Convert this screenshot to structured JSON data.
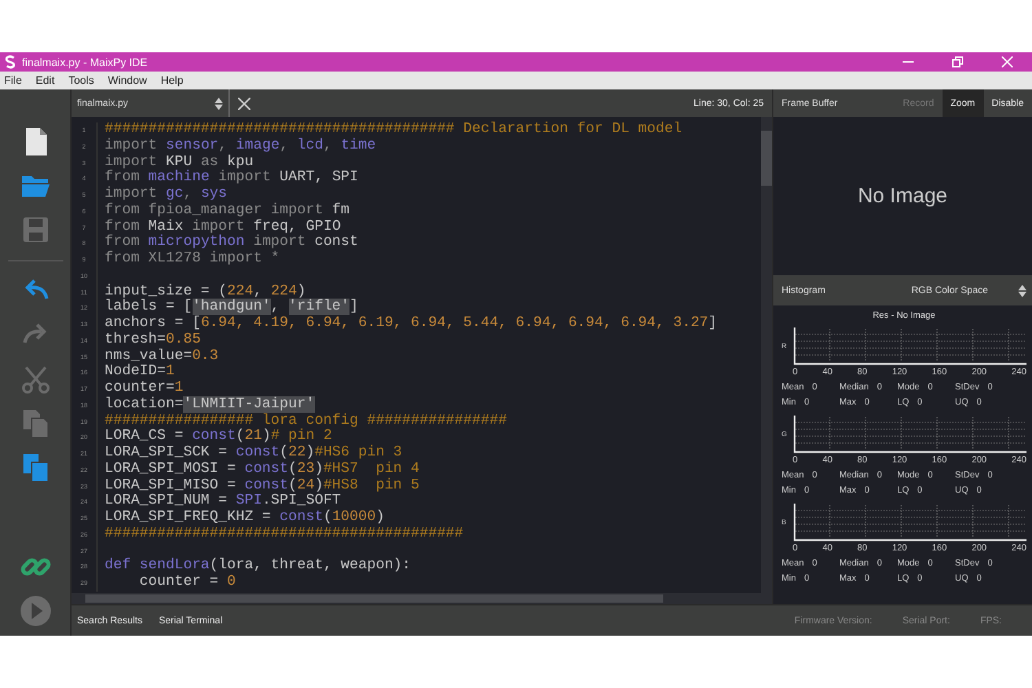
{
  "window": {
    "title": "finalmaix.py - MaixPy IDE"
  },
  "menu": [
    "File",
    "Edit",
    "Tools",
    "Window",
    "Help"
  ],
  "toolbar": [
    {
      "kind": "new",
      "enabled": true
    },
    {
      "kind": "open",
      "enabled": true
    },
    {
      "kind": "save",
      "enabled": false
    },
    {
      "kind": "undo",
      "enabled": true
    },
    {
      "kind": "redo",
      "enabled": false
    },
    {
      "kind": "cut",
      "enabled": false
    },
    {
      "kind": "copy",
      "enabled": false
    },
    {
      "kind": "paste",
      "enabled": true
    }
  ],
  "device_controls": [
    {
      "kind": "connect",
      "enabled": true
    },
    {
      "kind": "run",
      "enabled": false
    }
  ],
  "editor": {
    "file": "finalmaix.py",
    "cursor": "Line: 30, Col: 25",
    "lines": [
      {
        "number": "1",
        "tokens": [
          {
            "kind": "comment",
            "text": "######################################## Declarartion for DL model"
          }
        ]
      },
      {
        "number": "2",
        "tokens": [
          {
            "kind": "muted",
            "text": "import "
          },
          {
            "kind": "accent",
            "text": "sensor"
          },
          {
            "kind": "muted",
            "text": ", "
          },
          {
            "kind": "accent",
            "text": "image"
          },
          {
            "kind": "muted",
            "text": ", "
          },
          {
            "kind": "accent",
            "text": "lcd"
          },
          {
            "kind": "muted",
            "text": ", "
          },
          {
            "kind": "accent",
            "text": "time"
          }
        ]
      },
      {
        "number": "3",
        "tokens": [
          {
            "kind": "muted",
            "text": "import "
          },
          {
            "kind": "plain",
            "text": "KPU "
          },
          {
            "kind": "muted",
            "text": "as "
          },
          {
            "kind": "plain",
            "text": "kpu"
          }
        ]
      },
      {
        "number": "4",
        "tokens": [
          {
            "kind": "muted",
            "text": "from "
          },
          {
            "kind": "accent",
            "text": "machine"
          },
          {
            "kind": "muted",
            "text": " import "
          },
          {
            "kind": "plain",
            "text": "UART, SPI"
          }
        ]
      },
      {
        "number": "5",
        "tokens": [
          {
            "kind": "muted",
            "text": "import "
          },
          {
            "kind": "accent",
            "text": "gc"
          },
          {
            "kind": "muted",
            "text": ", "
          },
          {
            "kind": "accent",
            "text": "sys"
          }
        ]
      },
      {
        "number": "6",
        "tokens": [
          {
            "kind": "muted",
            "text": "from fpioa_manager import "
          },
          {
            "kind": "plain",
            "text": "fm"
          }
        ]
      },
      {
        "number": "7",
        "tokens": [
          {
            "kind": "muted",
            "text": "from "
          },
          {
            "kind": "plain",
            "text": "Maix "
          },
          {
            "kind": "muted",
            "text": "import "
          },
          {
            "kind": "plain",
            "text": "freq, GPIO"
          }
        ]
      },
      {
        "number": "8",
        "tokens": [
          {
            "kind": "muted",
            "text": "from "
          },
          {
            "kind": "accent",
            "text": "micropython"
          },
          {
            "kind": "muted",
            "text": " import "
          },
          {
            "kind": "plain",
            "text": "const"
          }
        ]
      },
      {
        "number": "9",
        "tokens": [
          {
            "kind": "muted",
            "text": "from XL1278 import *"
          }
        ]
      },
      {
        "number": "10"
      },
      {
        "number": "11",
        "tokens": [
          {
            "kind": "plain",
            "text": "input_size = ("
          },
          {
            "kind": "number",
            "text": "224"
          },
          {
            "kind": "plain",
            "text": ", "
          },
          {
            "kind": "number",
            "text": "224"
          },
          {
            "kind": "plain",
            "text": ")"
          }
        ]
      },
      {
        "number": "12",
        "tokens": [
          {
            "kind": "plain",
            "text": "labels = ["
          },
          {
            "kind": "string",
            "text": "'handgun'"
          },
          {
            "kind": "plain",
            "text": ", "
          },
          {
            "kind": "string",
            "text": "'rifle'"
          },
          {
            "kind": "plain",
            "text": "]"
          }
        ]
      },
      {
        "number": "13",
        "tokens": [
          {
            "kind": "plain",
            "text": "anchors = ["
          },
          {
            "kind": "number",
            "text": "6.94, 4.19, 6.94, 6.19, 6.94, 5.44, 6.94, 6.94, 6.94, 3.27"
          },
          {
            "kind": "plain",
            "text": "]"
          }
        ]
      },
      {
        "number": "14",
        "tokens": [
          {
            "kind": "plain",
            "text": "thresh="
          },
          {
            "kind": "number",
            "text": "0.85"
          }
        ]
      },
      {
        "number": "15",
        "tokens": [
          {
            "kind": "plain",
            "text": "nms_value="
          },
          {
            "kind": "number",
            "text": "0.3"
          }
        ]
      },
      {
        "number": "16",
        "tokens": [
          {
            "kind": "plain",
            "text": "NodeID="
          },
          {
            "kind": "number",
            "text": "1"
          }
        ]
      },
      {
        "number": "17",
        "tokens": [
          {
            "kind": "plain",
            "text": "counter="
          },
          {
            "kind": "number",
            "text": "1"
          }
        ]
      },
      {
        "number": "18",
        "tokens": [
          {
            "kind": "plain",
            "text": "location="
          },
          {
            "kind": "string",
            "text": "'LNMIIT-Jaipur'"
          }
        ]
      },
      {
        "number": "19",
        "tokens": [
          {
            "kind": "comment",
            "text": "################# lora config ################"
          }
        ]
      },
      {
        "number": "20",
        "tokens": [
          {
            "kind": "plain",
            "text": "LORA_CS = "
          },
          {
            "kind": "accent",
            "text": "const"
          },
          {
            "kind": "plain",
            "text": "("
          },
          {
            "kind": "number",
            "text": "21"
          },
          {
            "kind": "plain",
            "text": ")"
          },
          {
            "kind": "comment",
            "text": "# pin 2"
          }
        ]
      },
      {
        "number": "21",
        "tokens": [
          {
            "kind": "plain",
            "text": "LORA_SPI_SCK = "
          },
          {
            "kind": "accent",
            "text": "const"
          },
          {
            "kind": "plain",
            "text": "("
          },
          {
            "kind": "number",
            "text": "22"
          },
          {
            "kind": "plain",
            "text": ")"
          },
          {
            "kind": "comment",
            "text": "#HS6 pin 3"
          }
        ]
      },
      {
        "number": "22",
        "tokens": [
          {
            "kind": "plain",
            "text": "LORA_SPI_MOSI = "
          },
          {
            "kind": "accent",
            "text": "const"
          },
          {
            "kind": "plain",
            "text": "("
          },
          {
            "kind": "number",
            "text": "23"
          },
          {
            "kind": "plain",
            "text": ")"
          },
          {
            "kind": "comment",
            "text": "#HS7  pin 4"
          }
        ]
      },
      {
        "number": "23",
        "tokens": [
          {
            "kind": "plain",
            "text": "LORA_SPI_MISO = "
          },
          {
            "kind": "accent",
            "text": "const"
          },
          {
            "kind": "plain",
            "text": "("
          },
          {
            "kind": "number",
            "text": "24"
          },
          {
            "kind": "plain",
            "text": ")"
          },
          {
            "kind": "comment",
            "text": "#HS8  pin 5"
          }
        ]
      },
      {
        "number": "24",
        "tokens": [
          {
            "kind": "plain",
            "text": "LORA_SPI_NUM = "
          },
          {
            "kind": "accent",
            "text": "SPI"
          },
          {
            "kind": "plain",
            "text": ".SPI_SOFT"
          }
        ]
      },
      {
        "number": "25",
        "tokens": [
          {
            "kind": "plain",
            "text": "LORA_SPI_FREQ_KHZ = "
          },
          {
            "kind": "accent",
            "text": "const"
          },
          {
            "kind": "plain",
            "text": "("
          },
          {
            "kind": "number",
            "text": "10000"
          },
          {
            "kind": "plain",
            "text": ")"
          }
        ]
      },
      {
        "number": "26",
        "tokens": [
          {
            "kind": "comment",
            "text": "#########################################"
          }
        ]
      },
      {
        "number": "27"
      },
      {
        "number": "28",
        "tokens": [
          {
            "kind": "accent",
            "text": "def sendLora"
          },
          {
            "kind": "plain",
            "text": "(lora, threat, weapon):"
          }
        ]
      },
      {
        "number": "29",
        "tokens": [
          {
            "kind": "plain",
            "text": "    counter = "
          },
          {
            "kind": "number",
            "text": "0"
          }
        ]
      }
    ]
  },
  "frame_buffer": {
    "title": "Frame Buffer",
    "message": "No Image",
    "buttons": [
      {
        "label": "Record",
        "disabled": true,
        "selected": false
      },
      {
        "label": "Zoom",
        "disabled": false,
        "selected": true
      },
      {
        "label": "Disable",
        "disabled": false,
        "selected": false
      }
    ]
  },
  "histogram": {
    "title": "Histogram",
    "color_space": "RGB Color Space",
    "resolution": "Res - No Image",
    "channels": [
      {
        "label": "R",
        "ticks": [
          "0",
          "40",
          "80",
          "120",
          "160",
          "200",
          "240"
        ],
        "stats": [
          {
            "label": "Mean",
            "value": "0"
          },
          {
            "label": "Median",
            "value": "0"
          },
          {
            "label": "Mode",
            "value": "0"
          },
          {
            "label": "StDev",
            "value": "0"
          },
          {
            "label": "Min",
            "value": "0"
          },
          {
            "label": "Max",
            "value": "0"
          },
          {
            "label": "LQ",
            "value": "0"
          },
          {
            "label": "UQ",
            "value": "0"
          }
        ]
      },
      {
        "label": "G",
        "ticks": [
          "0",
          "40",
          "80",
          "120",
          "160",
          "200",
          "240"
        ],
        "stats": [
          {
            "label": "Mean",
            "value": "0"
          },
          {
            "label": "Median",
            "value": "0"
          },
          {
            "label": "Mode",
            "value": "0"
          },
          {
            "label": "StDev",
            "value": "0"
          },
          {
            "label": "Min",
            "value": "0"
          },
          {
            "label": "Max",
            "value": "0"
          },
          {
            "label": "LQ",
            "value": "0"
          },
          {
            "label": "UQ",
            "value": "0"
          }
        ]
      },
      {
        "label": "B",
        "ticks": [
          "0",
          "40",
          "80",
          "120",
          "160",
          "200",
          "240"
        ],
        "stats": [
          {
            "label": "Mean",
            "value": "0"
          },
          {
            "label": "Median",
            "value": "0"
          },
          {
            "label": "Mode",
            "value": "0"
          },
          {
            "label": "StDev",
            "value": "0"
          },
          {
            "label": "Min",
            "value": "0"
          },
          {
            "label": "Max",
            "value": "0"
          },
          {
            "label": "LQ",
            "value": "0"
          },
          {
            "label": "UQ",
            "value": "0"
          }
        ]
      }
    ]
  },
  "bottom_tabs": [
    "Search Results",
    "Serial Terminal"
  ],
  "status": [
    "Firmware Version:",
    "Serial Port:",
    "FPS:"
  ]
}
